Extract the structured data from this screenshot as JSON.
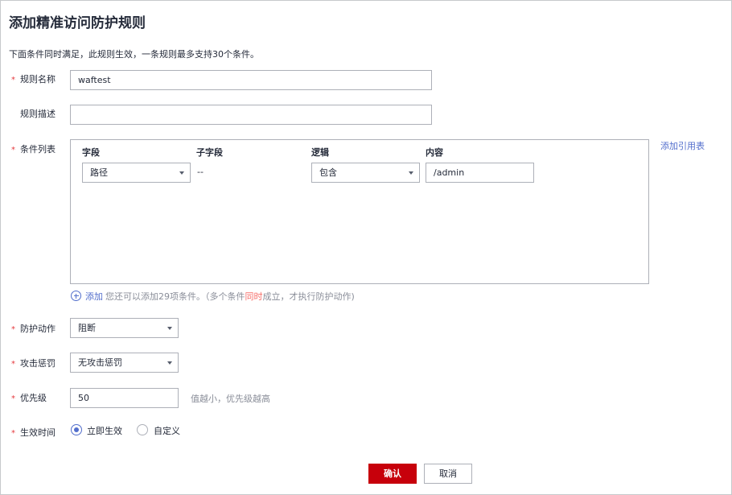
{
  "dialog": {
    "title": "添加精准访问防护规则",
    "subtitle": "下面条件同时满足，此规则生效，一条规则最多支持30个条件。"
  },
  "required_mark": "*",
  "rule_name": {
    "label": "规则名称",
    "value": "waftest"
  },
  "rule_desc": {
    "label": "规则描述",
    "value": ""
  },
  "conditions": {
    "label": "条件列表",
    "add_ref_table": "添加引用表",
    "headers": {
      "field": "字段",
      "subfield": "子字段",
      "logic": "逻辑",
      "content": "内容"
    },
    "row": {
      "field": "路径",
      "subfield": "--",
      "logic": "包含",
      "content": "/admin"
    },
    "add_link": "添加",
    "add_hint_prefix": "您还可以添加29项条件。（多个条件",
    "add_hint_highlight": "同时",
    "add_hint_suffix": "成立，才执行防护动作)"
  },
  "action": {
    "label": "防护动作",
    "value": "阻断"
  },
  "penalty": {
    "label": "攻击惩罚",
    "value": "无攻击惩罚"
  },
  "priority": {
    "label": "优先级",
    "value": "50",
    "hint": "值越小，优先级越高"
  },
  "effective_time": {
    "label": "生效时间",
    "options": [
      "立即生效",
      "自定义"
    ],
    "selected": "立即生效"
  },
  "buttons": {
    "confirm": "确认",
    "cancel": "取消"
  },
  "colors": {
    "primary": "#c7000b",
    "link": "#526ecc",
    "required": "#e5393e",
    "highlight": "#f66f6a"
  }
}
